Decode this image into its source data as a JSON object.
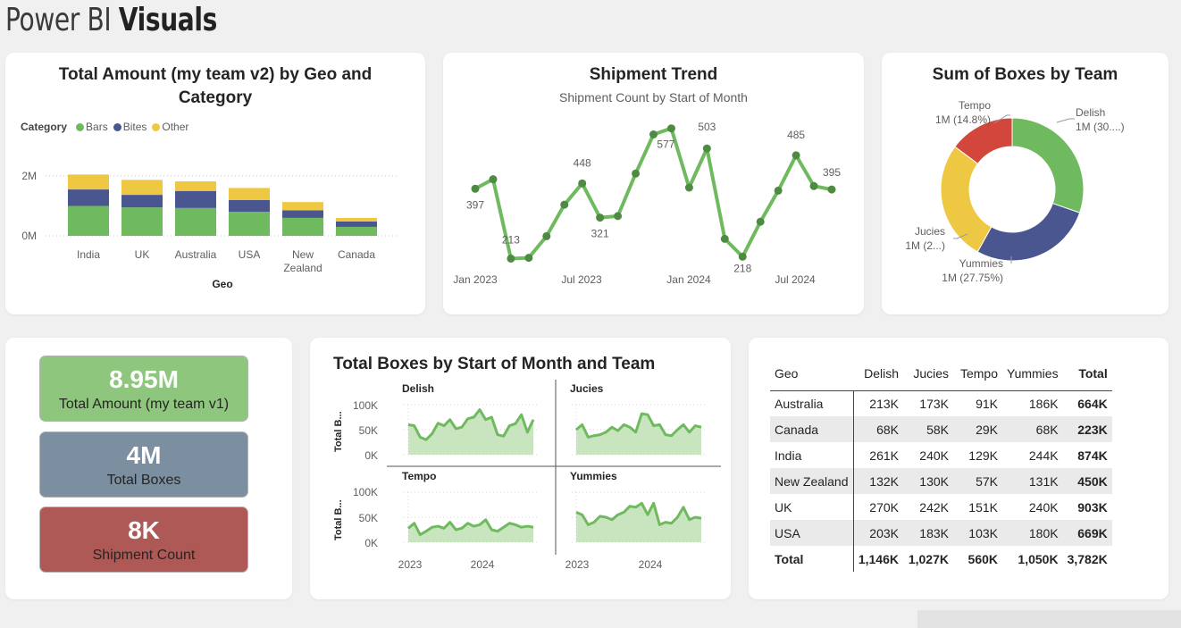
{
  "page": {
    "title_light": "Power BI ",
    "title_bold": "Visuals"
  },
  "colors": {
    "bars": "#6fba5f",
    "bites": "#4a568f",
    "other": "#efc843",
    "tempo": "#d2463c",
    "line": "#6fba5f",
    "marker": "#4f8a42",
    "area": "#c9e5c0",
    "kpi_green": "#8fc67e",
    "kpi_blue": "#7b8fa0",
    "kpi_red": "#ae5955"
  },
  "geo_chart": {
    "title": "Total Amount (my team v2) by Geo and Category",
    "legend_title": "Category",
    "legend": [
      "Bars",
      "Bites",
      "Other"
    ],
    "xlabel": "Geo",
    "yticks": [
      "2M",
      "0M"
    ]
  },
  "trend_chart": {
    "title": "Shipment Trend",
    "subtitle": "Shipment Count by Start of Month",
    "xticks": [
      "Jan 2023",
      "Jul 2023",
      "Jan 2024",
      "Jul 2024"
    ]
  },
  "donut_chart": {
    "title": "Sum of Boxes by Team",
    "labels": [
      {
        "name": "Delish",
        "value": "1M (30....)"
      },
      {
        "name": "Yummies",
        "value": "1M (27.75%)"
      },
      {
        "name": "Jucies",
        "value": "1M (2...)"
      },
      {
        "name": "Tempo",
        "value": "1M (14.8%)"
      }
    ]
  },
  "kpis": [
    {
      "value": "8.95M",
      "label": "Total Amount (my team v1)"
    },
    {
      "value": "4M",
      "label": "Total Boxes"
    },
    {
      "value": "8K",
      "label": "Shipment Count"
    }
  ],
  "small_multiples": {
    "title": "Total Boxes by Start of Month and Team",
    "ylabel": "Total B...",
    "yticks": [
      "100K",
      "50K",
      "0K"
    ],
    "xticks": [
      "2023",
      "2024"
    ],
    "panels": [
      "Delish",
      "Jucies",
      "Tempo",
      "Yummies"
    ]
  },
  "table": {
    "headers": [
      "Geo",
      "Delish",
      "Jucies",
      "Tempo",
      "Yummies",
      "Total"
    ],
    "rows": [
      [
        "Australia",
        "213K",
        "173K",
        "91K",
        "186K",
        "664K"
      ],
      [
        "Canada",
        "68K",
        "58K",
        "29K",
        "68K",
        "223K"
      ],
      [
        "India",
        "261K",
        "240K",
        "129K",
        "244K",
        "874K"
      ],
      [
        "New Zealand",
        "132K",
        "130K",
        "57K",
        "131K",
        "450K"
      ],
      [
        "UK",
        "270K",
        "242K",
        "151K",
        "240K",
        "903K"
      ],
      [
        "USA",
        "203K",
        "183K",
        "103K",
        "180K",
        "669K"
      ]
    ],
    "total_row": [
      "Total",
      "1,146K",
      "1,027K",
      "560K",
      "1,050K",
      "3,782K"
    ]
  },
  "chart_data": [
    {
      "type": "bar",
      "stacked": true,
      "title": "Total Amount (my team v2) by Geo and Category",
      "categories": [
        "India",
        "UK",
        "Australia",
        "USA",
        "New Zealand",
        "Canada"
      ],
      "series": [
        {
          "name": "Bars",
          "values": [
            1.0,
            0.95,
            0.93,
            0.8,
            0.6,
            0.3
          ]
        },
        {
          "name": "Bites",
          "values": [
            0.55,
            0.42,
            0.57,
            0.4,
            0.25,
            0.18
          ]
        },
        {
          "name": "Other",
          "values": [
            0.5,
            0.5,
            0.32,
            0.4,
            0.28,
            0.12
          ]
        }
      ],
      "xlabel": "Geo",
      "ylim": [
        0,
        2.0
      ]
    },
    {
      "type": "line",
      "title": "Shipment Trend",
      "subtitle": "Shipment Count by Start of Month",
      "x": [
        "Jan 2023",
        "Feb 2023",
        "Mar 2023",
        "Apr 2023",
        "May 2023",
        "Jun 2023",
        "Jul 2023",
        "Aug 2023",
        "Sep 2023",
        "Oct 2023",
        "Nov 2023",
        "Dec 2023",
        "Jan 2024",
        "Feb 2024",
        "Mar 2024",
        "Apr 2024",
        "May 2024",
        "Jun 2024",
        "Jul 2024",
        "Aug 2024",
        "Sep 2024"
      ],
      "values": [
        397,
        422,
        213,
        215,
        272,
        355,
        411,
        321,
        325,
        437,
        540,
        556,
        400,
        503,
        265,
        218,
        310,
        392,
        485,
        404,
        395
      ],
      "data_labels": [
        {
          "index": 0,
          "text": "397"
        },
        {
          "index": 2,
          "text": "213"
        },
        {
          "index": 6,
          "text": "448"
        },
        {
          "index": 7,
          "text": "321"
        },
        {
          "index": 11,
          "text": "577"
        },
        {
          "index": 13,
          "text": "503"
        },
        {
          "index": 15,
          "text": "218"
        },
        {
          "index": 18,
          "text": "485"
        },
        {
          "index": 20,
          "text": "395"
        }
      ],
      "ylim": [
        200,
        560
      ]
    },
    {
      "type": "pie",
      "donut": true,
      "title": "Sum of Boxes by Team",
      "categories": [
        "Delish",
        "Yummies",
        "Jucies",
        "Tempo"
      ],
      "values": [
        30.3,
        27.75,
        27.15,
        14.8
      ]
    },
    {
      "type": "area",
      "title": "Total Boxes by Start of Month and Team",
      "ylim": [
        0,
        100
      ],
      "series": [
        {
          "name": "Delish",
          "values": [
            60,
            58,
            35,
            30,
            42,
            63,
            58,
            70,
            52,
            55,
            72,
            75,
            90,
            70,
            75,
            40,
            37,
            58,
            62,
            80,
            45,
            70
          ]
        },
        {
          "name": "Jucies",
          "values": [
            50,
            60,
            35,
            38,
            40,
            45,
            55,
            48,
            60,
            55,
            45,
            82,
            80,
            58,
            60,
            40,
            38,
            50,
            60,
            45,
            58,
            55
          ]
        },
        {
          "name": "Tempo",
          "values": [
            28,
            38,
            15,
            22,
            30,
            32,
            28,
            40,
            25,
            28,
            38,
            32,
            35,
            45,
            25,
            22,
            30,
            38,
            35,
            30,
            32,
            30
          ]
        },
        {
          "name": "Yummies",
          "values": [
            60,
            55,
            35,
            40,
            52,
            50,
            45,
            55,
            60,
            72,
            70,
            78,
            55,
            78,
            35,
            40,
            38,
            50,
            70,
            45,
            50,
            48
          ]
        }
      ]
    }
  ]
}
